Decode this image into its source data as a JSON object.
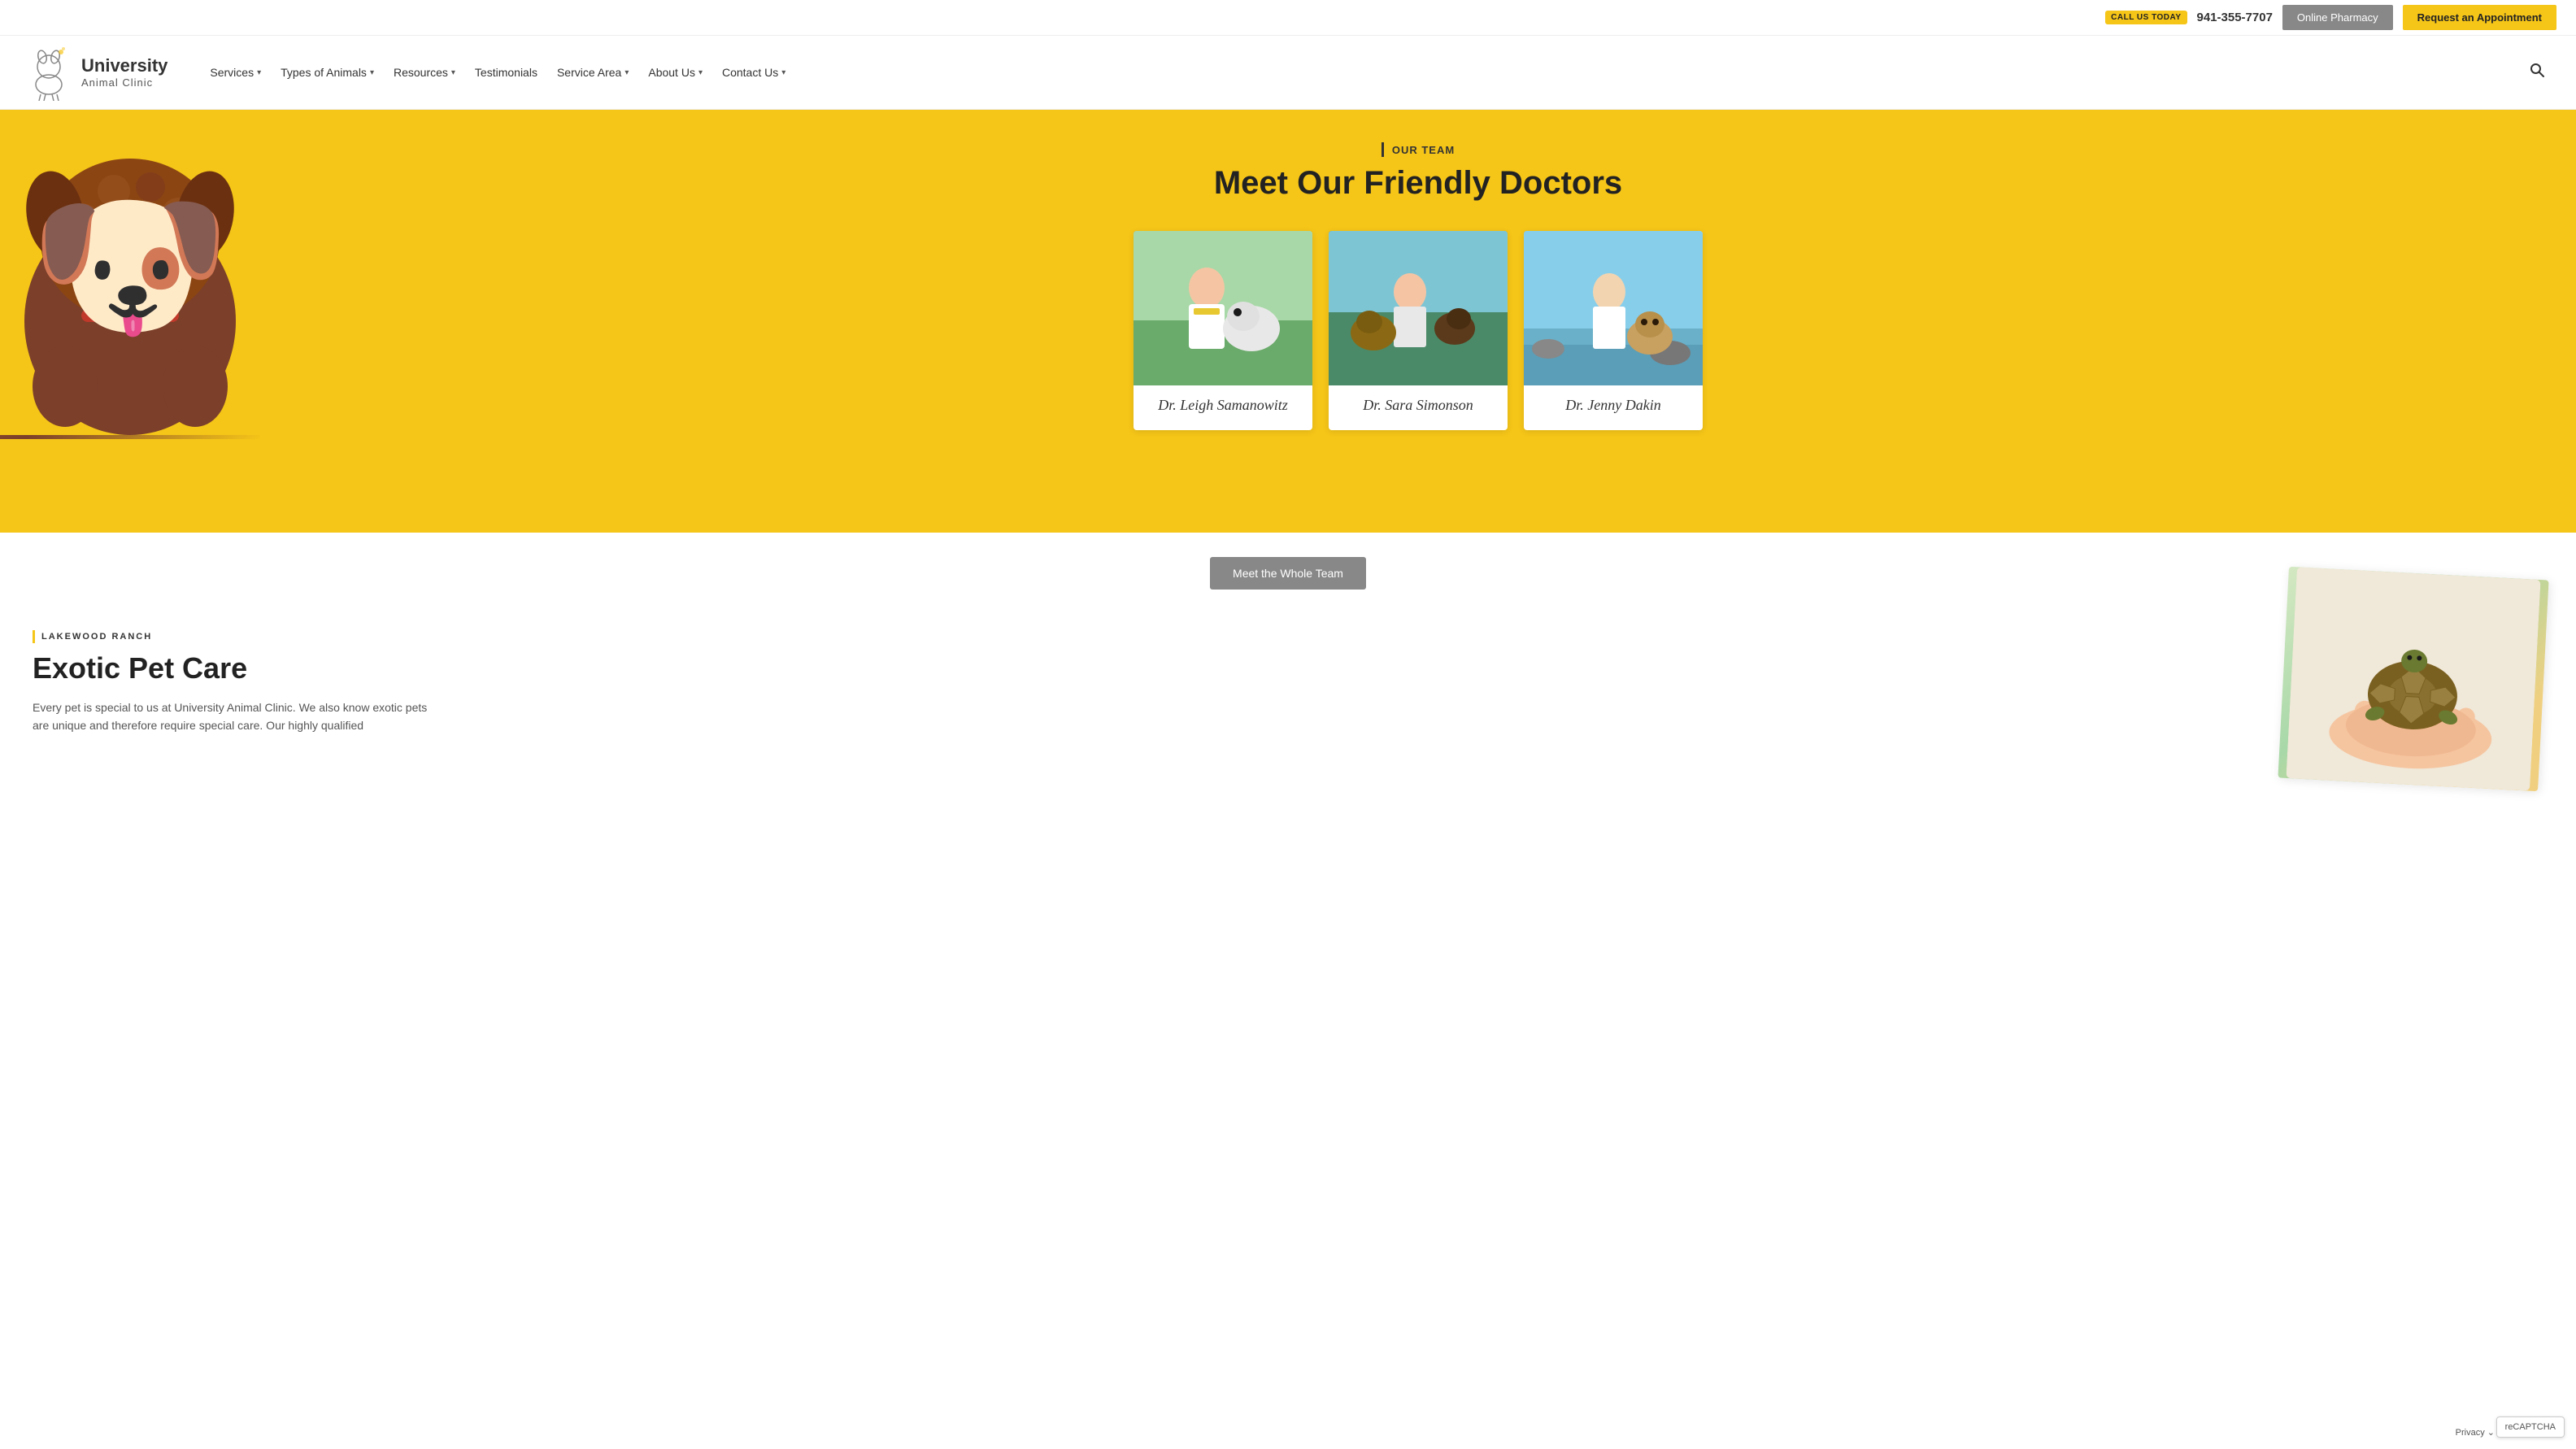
{
  "topbar": {
    "call_badge": "CALL US TODAY",
    "phone": "941-355-7707",
    "pharmacy_btn": "Online Pharmacy",
    "appointment_btn": "Request an Appointment"
  },
  "logo": {
    "university": "University",
    "animal_clinic": "Animal Clinic"
  },
  "nav": {
    "items": [
      {
        "label": "Services",
        "has_dropdown": true
      },
      {
        "label": "Types of Animals",
        "has_dropdown": true
      },
      {
        "label": "Resources",
        "has_dropdown": true
      },
      {
        "label": "Testimonials",
        "has_dropdown": false
      },
      {
        "label": "Service Area",
        "has_dropdown": true
      },
      {
        "label": "About Us",
        "has_dropdown": true
      },
      {
        "label": "Contact Us",
        "has_dropdown": true
      }
    ]
  },
  "hero": {
    "team_label": "OUR TEAM",
    "title": "Meet Our Friendly Doctors"
  },
  "doctors": [
    {
      "name": "Dr. Leigh Samanowitz",
      "img_class": "doc1"
    },
    {
      "name": "Dr. Sara Simonson",
      "img_class": "doc2"
    },
    {
      "name": "Dr. Jenny Dakin",
      "img_class": "doc3"
    }
  ],
  "meet_team_btn": "Meet the Whole Team",
  "exotic": {
    "label": "LAKEWOOD RANCH",
    "title": "Exotic Pet Care",
    "description": "Every pet is special to us at University Animal Clinic. We also know exotic pets are unique and therefore require special care. Our highly qualified"
  },
  "recaptcha": {
    "text": "reCAPTCHA"
  },
  "privacy": {
    "text": "Privacy ⌄"
  }
}
